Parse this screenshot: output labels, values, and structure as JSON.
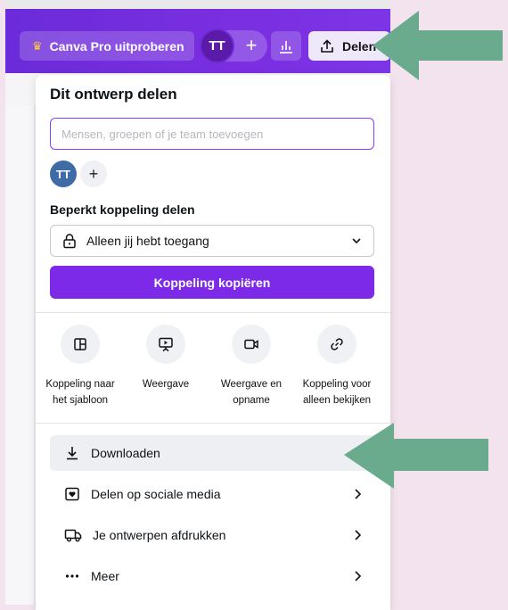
{
  "topbar": {
    "pro_label": "Canva Pro uitproberen",
    "avatar_initials": "TT",
    "add_label": "+",
    "share_label": "Delen"
  },
  "panel": {
    "title": "Dit ontwerp delen",
    "people_placeholder": "Mensen, groepen of je team toevoegen",
    "member_initials": "TT",
    "add_member": "+",
    "link_section_label": "Beperkt koppeling delen",
    "access_value": "Alleen jij hebt toegang",
    "copy_link_label": "Koppeling kopiëren",
    "options": [
      {
        "line1": "Koppeling naar",
        "line2": "het sjabloon",
        "icon": "template-icon"
      },
      {
        "line1": "Weergave",
        "line2": "",
        "icon": "presentation-icon"
      },
      {
        "line1": "Weergave en",
        "line2": "opname",
        "icon": "record-icon"
      },
      {
        "line1": "Koppeling voor",
        "line2": "alleen bekijken",
        "icon": "link-icon"
      }
    ],
    "menu": [
      {
        "label": "Downloaden",
        "icon": "download-icon"
      },
      {
        "label": "Delen op sociale media",
        "icon": "heart-icon"
      },
      {
        "label": "Je ontwerpen afdrukken",
        "icon": "truck-icon"
      },
      {
        "label": "Meer",
        "icon": "more-icon"
      }
    ]
  },
  "colors": {
    "brand_purple": "#7d2ae8",
    "annotation_green": "#6aab8e",
    "background_pink": "#f3e3ee"
  }
}
